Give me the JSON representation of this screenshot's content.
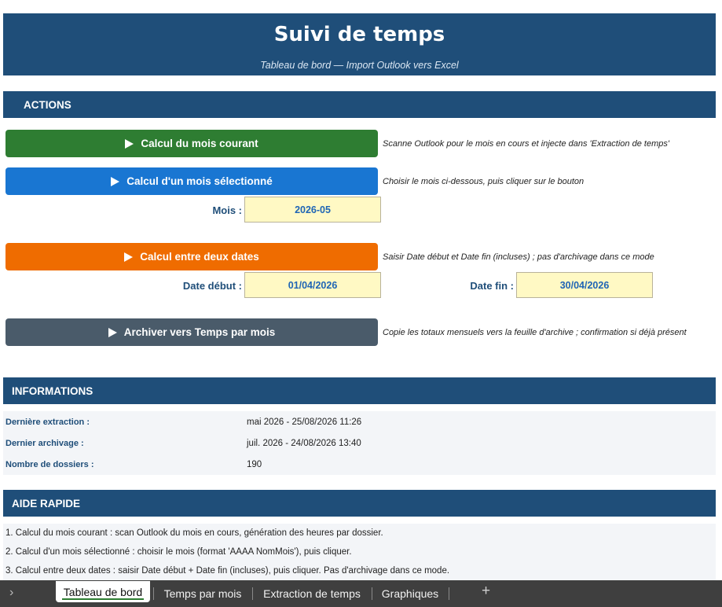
{
  "header": {
    "title": "Suivi de temps",
    "subtitle": "Tableau de bord — Import Outlook vers Excel"
  },
  "actions": {
    "section_title": "ACTIONS",
    "btn_current_month": {
      "label": "Calcul du mois courant",
      "hint": "Scanne Outlook pour le mois en cours et injecte dans 'Extraction de temps'"
    },
    "btn_selected_month": {
      "label": "Calcul d'un mois sélectionné",
      "hint": "Choisir le mois ci-dessous, puis cliquer sur le bouton"
    },
    "month_label": "Mois :",
    "month_value": "2026-05",
    "btn_between_dates": {
      "label": "Calcul entre deux dates",
      "hint": "Saisir Date début et Date fin (incluses) ; pas d'archivage dans ce mode"
    },
    "start_label": "Date début :",
    "start_value": "01/04/2026",
    "end_label": "Date fin :",
    "end_value": "30/04/2026",
    "btn_archive": {
      "label": "Archiver vers Temps par mois",
      "hint": "Copie les totaux mensuels vers la feuille d'archive ; confirmation si déjà présent"
    }
  },
  "informations": {
    "section_title": "INFORMATIONS",
    "rows": [
      {
        "label": "Dernière extraction :",
        "value": "mai 2026 - 25/08/2026 11:26"
      },
      {
        "label": "Dernier archivage :",
        "value": "juil. 2026 - 24/08/2026 13:40"
      },
      {
        "label": "Nombre de dossiers :",
        "value": "190"
      }
    ]
  },
  "help": {
    "section_title": "AIDE RAPIDE",
    "lines": [
      "1.  Calcul du mois courant : scan Outlook du mois en cours, génération des heures par dossier.",
      "2.  Calcul d'un mois sélectionné : choisir le mois (format 'AAAA NomMois'), puis cliquer.",
      "3.  Calcul entre deux dates : saisir Date début + Date fin (incluses), puis cliquer. Pas d'archivage dans ce mode."
    ]
  },
  "sheet_tabs": {
    "nav_icon": "chevron-right-icon",
    "tabs": [
      "Tableau de bord",
      "Temps par mois",
      "Extraction de temps",
      "Graphiques"
    ],
    "active_index": 0,
    "add_icon": "plus-icon"
  },
  "colors": {
    "header_bg": "#1f4e79",
    "btn_green": "#2e7d32",
    "btn_blue": "#1976d2",
    "btn_orange": "#ef6c00",
    "btn_gray": "#4a5b6a",
    "input_bg": "#fff9c4",
    "tabbar_bg": "#3f3f3f"
  }
}
